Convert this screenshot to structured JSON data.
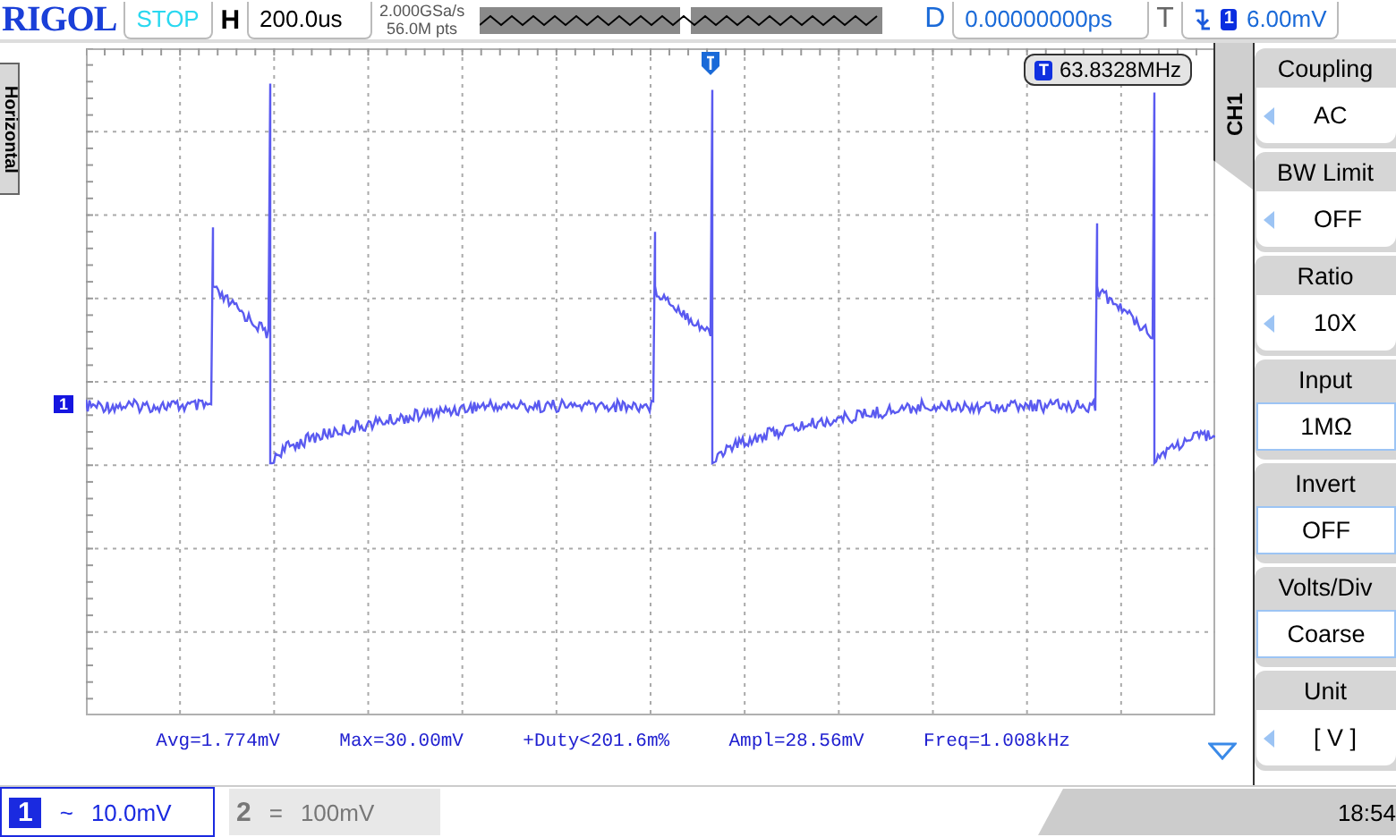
{
  "header": {
    "brand": "RIGOL",
    "run_state": "STOP",
    "horizontal_label": "H",
    "timebase": "200.0us",
    "sample_rate": "2.000GSa/s",
    "memory_depth": "56.0M pts",
    "delay_label": "D",
    "delay": "0.00000000ps",
    "trigger_label": "T",
    "trigger_source": "1",
    "trigger_level": "6.00mV"
  },
  "left_tab": {
    "label": "Horizontal"
  },
  "frequency_counter": {
    "badge": "T",
    "value": "63.8328MHz"
  },
  "channel_marker": "1",
  "side_tab": "CH1",
  "menu": [
    {
      "label": "Coupling",
      "value": "AC",
      "kind": "arrow"
    },
    {
      "label": "BW Limit",
      "value": "OFF",
      "kind": "arrow"
    },
    {
      "label": "Ratio",
      "value": "10X",
      "kind": "arrow"
    },
    {
      "label": "Input",
      "value": "1MΩ",
      "kind": "box"
    },
    {
      "label": "Invert",
      "value": "OFF",
      "kind": "box"
    },
    {
      "label": "Volts/Div",
      "value": "Coarse",
      "kind": "box"
    },
    {
      "label": "Unit",
      "value": "[  V  ]",
      "kind": "arrow"
    }
  ],
  "measurements": [
    "Avg=1.774mV",
    "Max=30.00mV",
    "+Duty<201.6m%",
    "Ampl=28.56mV",
    "Freq=1.008kHz"
  ],
  "channels": [
    {
      "number": "1",
      "coupling": "~",
      "scale": "10.0mV",
      "selected": true
    },
    {
      "number": "2",
      "coupling": "=",
      "scale": "100mV",
      "selected": false
    }
  ],
  "time": "18:54"
}
